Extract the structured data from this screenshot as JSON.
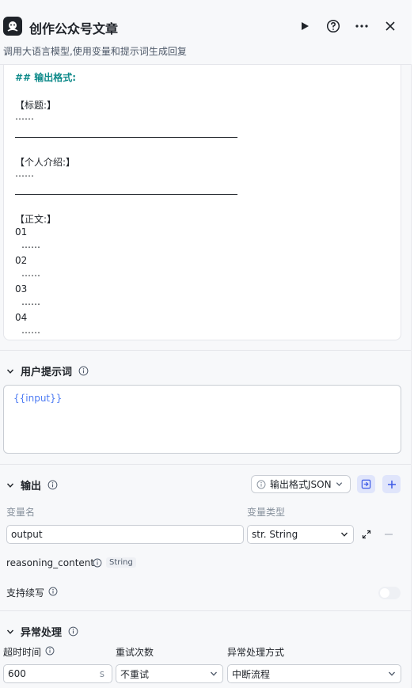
{
  "header": {
    "title": "创作公众号文章",
    "subtitle": "调用大语言模型,使用变量和提示词生成回复"
  },
  "system_prompt": {
    "heading": "## 输出格式:",
    "title_label": "【标题:】",
    "dots": "……",
    "intro_label": "【个人介绍:】",
    "body_label": "【正文:】",
    "n1": "01",
    "n2": "02",
    "n3": "03",
    "n4": "04"
  },
  "user_prompt": {
    "title": "用户提示词",
    "value": "{{input}}"
  },
  "output": {
    "title": "输出",
    "format_button": "输出格式JSON",
    "var_name_label": "变量名",
    "var_type_label": "变量类型",
    "var_name_value": "output",
    "var_type_value": "str. String",
    "reasoning_label": "reasoning_content",
    "reasoning_type": "String",
    "continue_label": "支持续写",
    "continue_enabled": false
  },
  "exception": {
    "title": "异常处理",
    "timeout_label": "超时时间",
    "retry_label": "重试次数",
    "handling_label": "异常处理方式",
    "timeout_value": "600",
    "timeout_unit": "s",
    "retry_value": "不重试",
    "handling_value": "中断流程"
  }
}
